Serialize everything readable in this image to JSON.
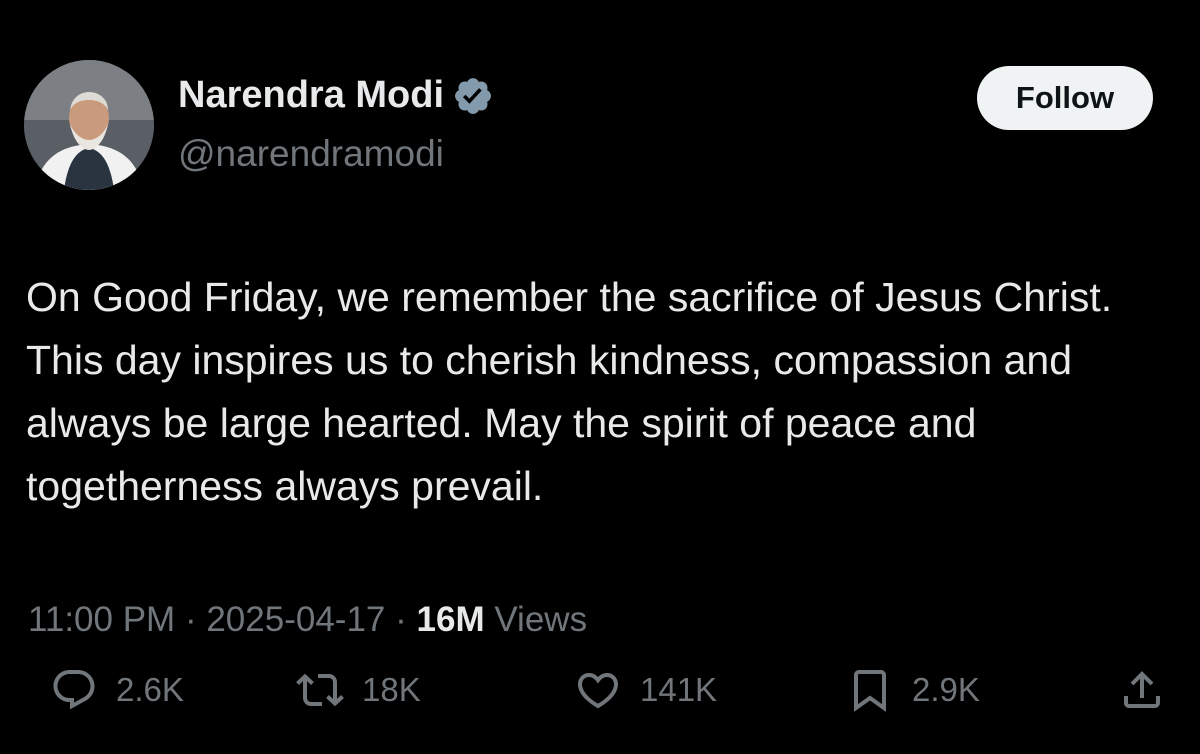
{
  "author": {
    "name": "Narendra Modi",
    "handle": "@narendramodi"
  },
  "follow_label": "Follow",
  "tweet_text": "On Good Friday, we remember the sacrifice of Jesus Christ. This day inspires us to cherish kindness, compassion and always be large hearted. May the spirit of peace and togetherness always prevail.",
  "meta": {
    "time": "11:00 PM",
    "separator": "·",
    "date": "2025-04-17",
    "views_count": "16M",
    "views_label": "Views"
  },
  "actions": {
    "replies": "2.6K",
    "reposts": "18K",
    "likes": "141K",
    "bookmarks": "2.9K"
  },
  "icons": {
    "verified": "verified-badge-icon",
    "reply": "reply-bubble-icon",
    "repost": "repost-arrows-icon",
    "like": "heart-icon",
    "bookmark": "bookmark-icon",
    "share": "share-upload-icon"
  },
  "colors": {
    "background": "#000000",
    "text": "#e7e9ea",
    "secondary": "#71767b",
    "verified_badge": "#829aab",
    "follow_bg": "#eff3f4"
  }
}
